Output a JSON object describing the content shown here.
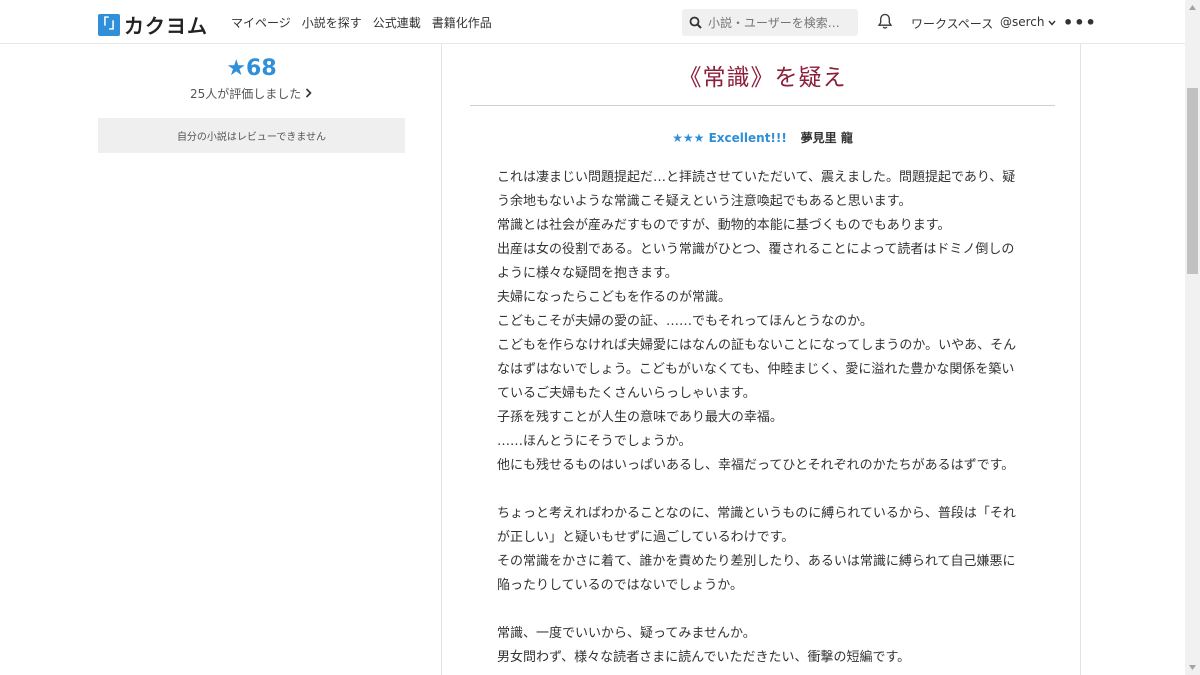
{
  "header": {
    "logo_mark": "「」",
    "logo_text": "カクヨム",
    "nav": [
      "マイページ",
      "小説を探す",
      "公式連載",
      "書籍化作品"
    ],
    "search_placeholder": "小説・ユーザーを検索…",
    "workspace": "ワークスペース",
    "username": "@serch"
  },
  "sidebar": {
    "star_rating": "★68",
    "rating_count": "25人が評価しました",
    "review_notice": "自分の小説はレビューできません"
  },
  "review": {
    "title": "《常識》を疑え",
    "stars": "★★★ Excellent!!!",
    "author": "夢見里 龍",
    "lines": [
      "これは凄まじい問題提起だ…と拝読させていただいて、震えました。問題提起であり、疑",
      "う余地もないような常識こそ疑えという注意喚起でもあると思います。",
      "常識とは社会が産みだすものですが、動物的本能に基づくものでもあります。",
      "出産は女の役割である。という常識がひとつ、覆されることによって読者はドミノ倒しの",
      "ように様々な疑問を抱きます。",
      "夫婦になったらこどもを作るのが常識。",
      "こどもこそが夫婦の愛の証、……でもそれってほんとうなのか。",
      "こどもを作らなければ夫婦愛にはなんの証もないことになってしまうのか。いやあ、そん",
      "なはずはないでしょう。こどもがいなくても、仲睦まじく、愛に溢れた豊かな関係を築い",
      "ているご夫婦もたくさんいらっしゃいます。",
      "子孫を残すことが人生の意味であり最大の幸福。",
      "……ほんとうにそうでしょうか。",
      "他にも残せるものはいっぱいあるし、幸福だってひとそれぞれのかたちがあるはずです。",
      "",
      "ちょっと考えればわかることなのに、常識というものに縛られているから、普段は「それ",
      "が正しい」と疑いもせずに過ごしているわけです。",
      "その常識をかさに着て、誰かを責めたり差別したり、あるいは常識に縛られて自己嫌悪に",
      "陥ったりしているのではないでしょうか。",
      "",
      "常識、一度でいいから、疑ってみませんか。",
      "男女問わず、様々な読者さまに読んでいただきたい、衝撃の短編です。"
    ]
  },
  "colors": {
    "accent": "#2f8fd8",
    "title": "#8b1f3a"
  }
}
